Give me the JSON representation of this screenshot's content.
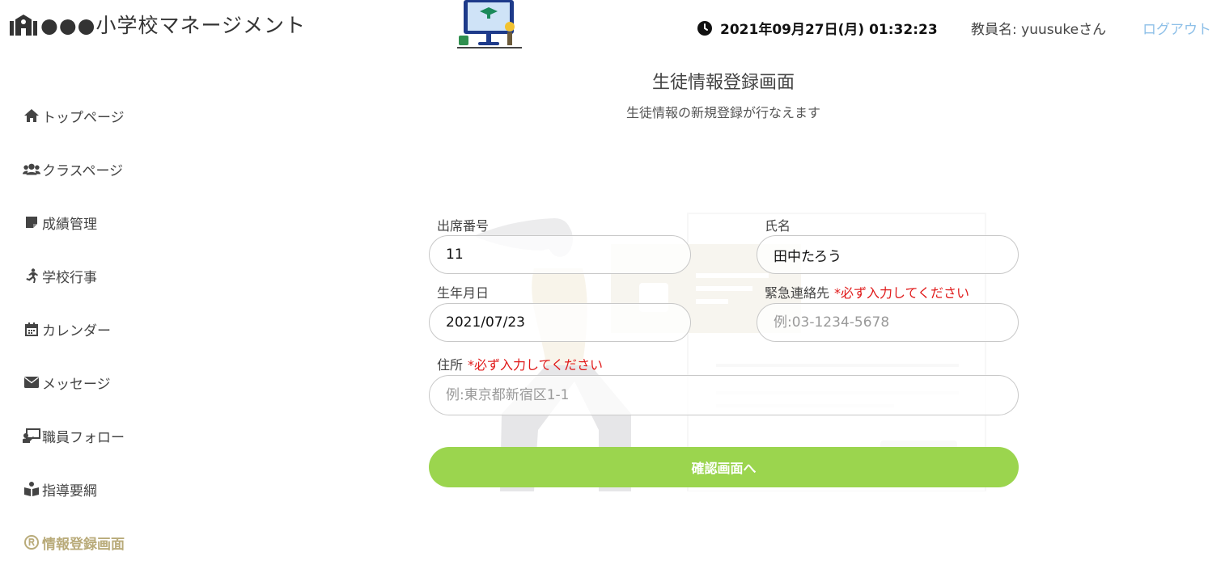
{
  "header": {
    "app_title": "●●●小学校マネージメント",
    "datetime": "2021年09月27日(月) 01:32:23",
    "teacher": "教員名: yuusukeさん",
    "logout": "ログアウト"
  },
  "sidebar": {
    "items": [
      {
        "label": "トップページ",
        "icon": "home-icon"
      },
      {
        "label": "クラスページ",
        "icon": "users-icon"
      },
      {
        "label": "成績管理",
        "icon": "note-icon"
      },
      {
        "label": "学校行事",
        "icon": "running-icon"
      },
      {
        "label": "カレンダー",
        "icon": "calendar-icon"
      },
      {
        "label": "メッセージ",
        "icon": "envelope-icon"
      },
      {
        "label": "職員フォロー",
        "icon": "chalkboard-teacher-icon"
      },
      {
        "label": "指導要綱",
        "icon": "book-reader-icon"
      },
      {
        "label": "情報登録画面",
        "icon": "registered-icon",
        "active": true
      }
    ]
  },
  "main": {
    "title": "生徒情報登録画面",
    "subtitle": "生徒情報の新規登録が行なえます",
    "form": {
      "attendance_no": {
        "label": "出席番号",
        "value": "11"
      },
      "name": {
        "label": "氏名",
        "value": "田中たろう"
      },
      "birthdate": {
        "label": "生年月日",
        "value": "2021/07/23"
      },
      "emergency": {
        "label": "緊急連絡先",
        "required": "*必ず入力してください",
        "placeholder": "例:03-1234-5678"
      },
      "address": {
        "label": "住所",
        "required": "*必ず入力してください",
        "placeholder": "例:東京都新宿区1-1"
      },
      "submit": "確認画面へ"
    }
  },
  "colors": {
    "accent_green": "#9bd54e",
    "active_nav": "#b9ab7a",
    "required_red": "#e01a1a",
    "logout_blue": "#8ec0e8"
  }
}
